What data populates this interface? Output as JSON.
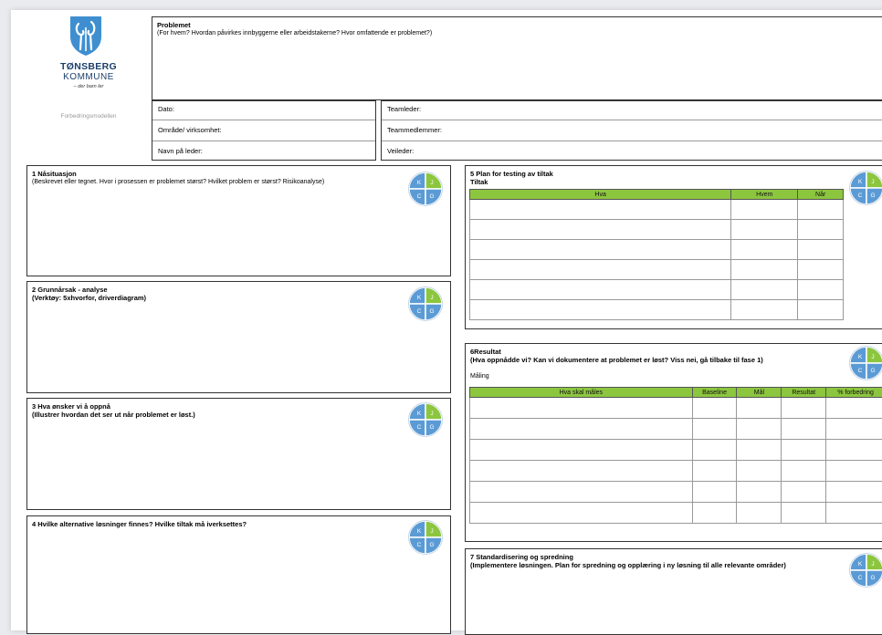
{
  "logo": {
    "name_line1": "TØNSBERG",
    "name_line2": "KOMMUNE",
    "tagline": "– der barn ler",
    "model_label": "Forbedringsmodellen",
    "colors": {
      "blue": "#3f8fd0",
      "dark": "#1b3f6b"
    }
  },
  "problem": {
    "title": "Problemet",
    "subtitle": "(For hvem? Hvordan påvirkes innbyggerne eller arbeidstakerne? Hvor omfattende er problemet?)"
  },
  "info_left": {
    "date_label": "Dato:",
    "area_label": "Område/ virksomhet:",
    "leader_label": "Navn på leder:"
  },
  "info_right": {
    "teamleader_label": "Teamleder:",
    "members_label": "Teammedlemmer:",
    "guide_label": "Veileder:"
  },
  "section1": {
    "title": "1 Nåsituasjon",
    "subtitle": "(Beskrevet eller tegnet. Hvor i prosessen er problemet størst? Hvilket problem er størst? Risikoanalyse)"
  },
  "section2": {
    "title": "2 Grunnårsak - analyse",
    "subtitle": "(Verktøy: 5xhvorfor, driverdiagram)"
  },
  "section3": {
    "title": "3 Hva ønsker vi å oppnå",
    "subtitle": "(Illustrer hvordan det ser ut når problemet er løst.)"
  },
  "section4": {
    "title": "4 Hvilke alternative løsninger finnes? Hvilke tiltak må iverksettes?"
  },
  "section5": {
    "title": "5 Plan for testing av tiltak",
    "subtitle": "Tiltak",
    "columns": [
      "Hva",
      "Hvem",
      "Når"
    ]
  },
  "section6": {
    "title": "6Resultat",
    "subtitle": "(Hva oppnådde vi? Kan vi dokumentere at problemet er løst? Viss nei, gå tilbake til fase 1)",
    "label": "Måling",
    "columns": [
      "Hva skal måles",
      "Baseline",
      "Mål",
      "Resultat",
      "% forbedring"
    ]
  },
  "section7": {
    "title": "7 Standardisering og spredning",
    "subtitle": "(Implementere løsningen. Plan for spredning og opplæring i ny løsning til alle relevante områder)"
  },
  "kcg": {
    "letters": [
      "K",
      "J",
      "C",
      "G"
    ],
    "colors": {
      "blue": "#5b9bd5",
      "green": "#8cc63f"
    }
  }
}
